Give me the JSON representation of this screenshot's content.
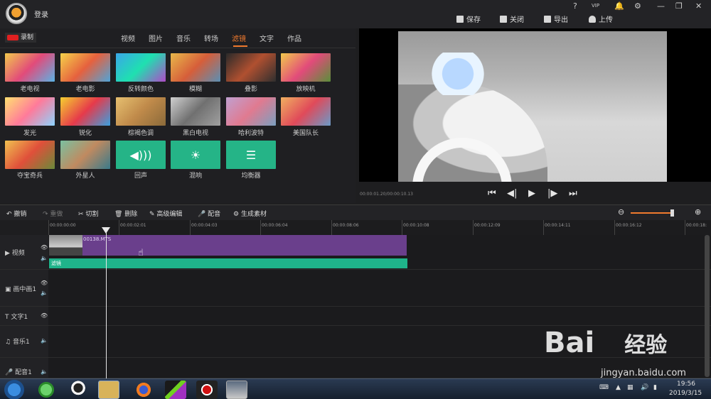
{
  "topbar": {
    "login": "登录",
    "help": "?",
    "vip": "VIP",
    "actions": [
      {
        "label": "保存"
      },
      {
        "label": "关闭"
      },
      {
        "label": "导出"
      },
      {
        "label": "上传"
      }
    ]
  },
  "media": {
    "record_label": "录制",
    "tabs": [
      "视频",
      "图片",
      "音乐",
      "转场",
      "滤镜",
      "文字",
      "作品"
    ],
    "active_tab": "滤镜",
    "filters": [
      {
        "label": "老电视"
      },
      {
        "label": "老电影"
      },
      {
        "label": "反转颜色"
      },
      {
        "label": "模糊"
      },
      {
        "label": "叠影"
      },
      {
        "label": "放映机"
      },
      {
        "label": "发光"
      },
      {
        "label": "锐化"
      },
      {
        "label": "棕褐色调"
      },
      {
        "label": "黑白电视"
      },
      {
        "label": "哈利波特"
      },
      {
        "label": "美国队长"
      },
      {
        "label": "夺宝奇兵"
      },
      {
        "label": "外星人"
      },
      {
        "label": "回声"
      },
      {
        "label": "混响"
      },
      {
        "label": "均衡器"
      }
    ]
  },
  "preview": {
    "timecode": "00:00:01.20/00:00:10.13"
  },
  "edit_toolbar": {
    "undo": "撤销",
    "redo": "重做",
    "cut": "切割",
    "delete": "删除",
    "advanced": "高级编辑",
    "dub": "配音",
    "generate": "生成素材"
  },
  "ruler": {
    "ticks": [
      "00:00:00:00",
      "00:00:02:01",
      "00:00:04:03",
      "00:00:06:04",
      "00:00:08:06",
      "00:00:10:08",
      "00:00:12:09",
      "00:00:14:11",
      "00:00:16:12",
      "00:00:18:"
    ]
  },
  "tracks": {
    "video": "视频",
    "pip": "画中画1",
    "text": "文字1",
    "music": "音乐1",
    "dub": "配音1"
  },
  "clip": {
    "name": "00138.MTS",
    "fx": "滤镜"
  },
  "watermark": {
    "brand": "Bai",
    "brand2": "经验",
    "url": "jingyan.baidu.com"
  },
  "taskbar": {
    "time": "19:56",
    "date": "2019/3/15"
  }
}
